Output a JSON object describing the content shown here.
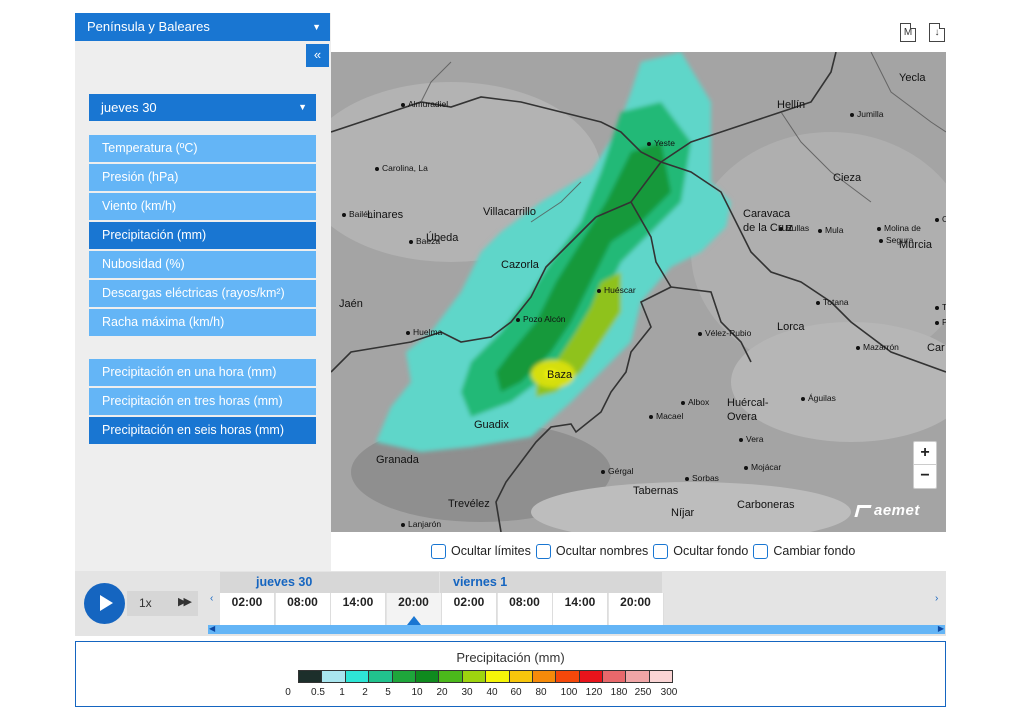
{
  "region_select": {
    "value": "Península y Baleares"
  },
  "collapse_label": "«",
  "day_select": {
    "value": "jueves 30"
  },
  "variables": [
    {
      "label": "Temperatura (ºC)",
      "active": false
    },
    {
      "label": "Presión (hPa)",
      "active": false
    },
    {
      "label": "Viento (km/h)",
      "active": false
    },
    {
      "label": "Precipitación (mm)",
      "active": true
    },
    {
      "label": "Nubosidad (%)",
      "active": false
    },
    {
      "label": "Descargas eléctricas (rayos/km²)",
      "active": false
    },
    {
      "label": "Racha máxima (km/h)",
      "active": false
    }
  ],
  "accumulations": [
    {
      "label": "Precipitación en una hora (mm)",
      "active": false
    },
    {
      "label": "Precipitación en tres horas (mm)",
      "active": false
    },
    {
      "label": "Precipitación en seis horas (mm)",
      "active": true
    }
  ],
  "top_icons": [
    {
      "name": "m-file-icon",
      "glyph": "M"
    },
    {
      "name": "download-icon",
      "glyph": "↓"
    }
  ],
  "map": {
    "places": [
      {
        "name": "Almuradiel",
        "size": "small"
      },
      {
        "name": "Carolina, La",
        "size": "small"
      },
      {
        "name": "Bailén",
        "size": "small"
      },
      {
        "name": "Linares",
        "size": "big"
      },
      {
        "name": "Baeza",
        "size": "small"
      },
      {
        "name": "Úbeda",
        "size": "big"
      },
      {
        "name": "Villacarrillo",
        "size": "big"
      },
      {
        "name": "Cazorla",
        "size": "big"
      },
      {
        "name": "Jaén",
        "size": "big"
      },
      {
        "name": "Huelma",
        "size": "small"
      },
      {
        "name": "Pozo Alcón",
        "size": "small"
      },
      {
        "name": "Huéscar",
        "size": "small"
      },
      {
        "name": "Baza",
        "size": "big"
      },
      {
        "name": "Guadix",
        "size": "big"
      },
      {
        "name": "Granada",
        "size": "big"
      },
      {
        "name": "Trevélez",
        "size": "big"
      },
      {
        "name": "Lanjarón",
        "size": "small"
      },
      {
        "name": "Yeste",
        "size": "small"
      },
      {
        "name": "Hellín",
        "size": "big"
      },
      {
        "name": "Jumilla",
        "size": "small"
      },
      {
        "name": "Yecla",
        "size": "big"
      },
      {
        "name": "Cieza",
        "size": "big"
      },
      {
        "name": "Caravaca",
        "size": "big"
      },
      {
        "name": "de la Cruz",
        "size": "big"
      },
      {
        "name": "Bullas",
        "size": "small"
      },
      {
        "name": "Mula",
        "size": "small"
      },
      {
        "name": "Molina de",
        "size": "small"
      },
      {
        "name": "Segura",
        "size": "small"
      },
      {
        "name": "Murcia",
        "size": "big"
      },
      {
        "name": "Totana",
        "size": "small"
      },
      {
        "name": "Lorca",
        "size": "big"
      },
      {
        "name": "Vélez-Rubio",
        "size": "small"
      },
      {
        "name": "Mazarrón",
        "size": "small"
      },
      {
        "name": "Águilas",
        "size": "small"
      },
      {
        "name": "Albox",
        "size": "small"
      },
      {
        "name": "Huércal-",
        "size": "big"
      },
      {
        "name": "Overa",
        "size": "big"
      },
      {
        "name": "Macael",
        "size": "small"
      },
      {
        "name": "Vera",
        "size": "small"
      },
      {
        "name": "Mojácar",
        "size": "small"
      },
      {
        "name": "Gérgal",
        "size": "small"
      },
      {
        "name": "Tabernas",
        "size": "big"
      },
      {
        "name": "Sorbas",
        "size": "small"
      },
      {
        "name": "Carboneras",
        "size": "big"
      },
      {
        "name": "Níjar",
        "size": "big"
      },
      {
        "name": "Or",
        "size": "small"
      },
      {
        "name": "To",
        "size": "small"
      },
      {
        "name": "Pa",
        "size": "small"
      },
      {
        "name": "Car",
        "size": "big"
      }
    ],
    "brand": "aemet",
    "zoom_in": "+",
    "zoom_out": "−"
  },
  "toggles": [
    "Ocultar límites",
    "Ocultar nombres",
    "Ocultar fondo",
    "Cambiar fondo"
  ],
  "player": {
    "speed": "1x",
    "ff_glyph": "▶▶"
  },
  "timeline": {
    "days": [
      "jueves 30",
      "viernes 1"
    ],
    "hours": [
      "02:00",
      "08:00",
      "14:00",
      "20:00",
      "02:00",
      "08:00",
      "14:00",
      "20:00"
    ],
    "active_hour_index": 3,
    "arrow_left": "‹",
    "arrow_right": "›"
  },
  "legend": {
    "title": "Precipitación (mm)",
    "colors": [
      "#1c2f2b",
      "#a9e6ef",
      "#2ee6d6",
      "#21c28d",
      "#1ea63b",
      "#0f8a1e",
      "#4bb81b",
      "#9ed40f",
      "#f5f508",
      "#f7c60c",
      "#f58a0a",
      "#f5480a",
      "#e8141b",
      "#e8686b",
      "#f0a5a6",
      "#fad4d4"
    ],
    "ticks": [
      "0",
      "0.5",
      "1",
      "2",
      "5",
      "10",
      "20",
      "30",
      "40",
      "60",
      "80",
      "100",
      "120",
      "180",
      "250",
      "300"
    ]
  }
}
